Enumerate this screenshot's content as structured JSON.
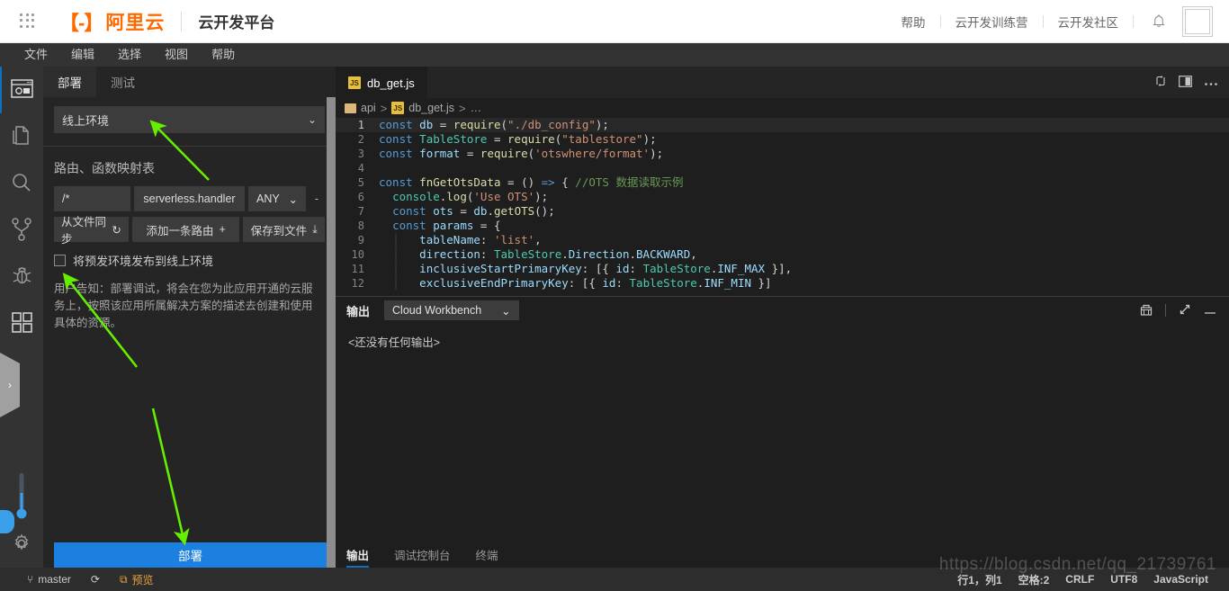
{
  "header": {
    "logo_mark": "【-】",
    "logo_text": "阿里云",
    "product": "云开发平台",
    "links": [
      "帮助",
      "云开发训练营",
      "云开发社区"
    ],
    "bell_icon": "bell-icon",
    "avatar_icon": "avatar-placeholder"
  },
  "menubar": {
    "items": [
      "文件",
      "编辑",
      "选择",
      "视图",
      "帮助"
    ]
  },
  "activitybar": {
    "items": [
      {
        "name": "cloud-workbench",
        "icon": "browser-window-icon",
        "active": true
      },
      {
        "name": "explorer",
        "icon": "files-icon",
        "active": false
      },
      {
        "name": "search",
        "icon": "search-icon",
        "active": false
      },
      {
        "name": "source-control",
        "icon": "git-branch-icon",
        "active": false
      },
      {
        "name": "debug",
        "icon": "bug-icon",
        "active": false
      },
      {
        "name": "extensions",
        "icon": "grid-squares-icon",
        "active": false
      }
    ],
    "bottom": [
      {
        "name": "thermometer",
        "icon": "thermometer-icon"
      },
      {
        "name": "settings",
        "icon": "gear-icon"
      }
    ],
    "flyout_chevron": "›"
  },
  "sidepanel": {
    "tabs": [
      {
        "label": "部署",
        "active": true
      },
      {
        "label": "测试",
        "active": false
      }
    ],
    "environment": {
      "value": "线上环境",
      "chevron": "⌄"
    },
    "section_title": "路由、函数映射表",
    "route_row": {
      "path": "/*",
      "handler": "serverless.handler",
      "method": "ANY",
      "method_chevron": "⌄",
      "delete": "-"
    },
    "buttons": [
      {
        "label": "从文件同步",
        "icon": "sync-icon",
        "glyph": "↻"
      },
      {
        "label": "添加一条路由",
        "icon": "plus-icon",
        "glyph": "+"
      },
      {
        "label": "保存到文件",
        "icon": "download-icon",
        "glyph": "⤓"
      }
    ],
    "checkbox": {
      "label": "将预发环境发布到线上环境",
      "checked": false
    },
    "note": "用户告知：部署调试，将会在您为此应用开通的云服务上，按照该应用所属解决方案的描述去创建和使用具体的资源。",
    "deploy_button": "部署"
  },
  "editor": {
    "tab": {
      "filename": "db_get.js",
      "badge": "JS"
    },
    "tab_icons": [
      "split-editor-icon",
      "split-layout-icon",
      "more-actions-icon"
    ],
    "breadcrumb": {
      "folder": "api",
      "file": "db_get.js",
      "ellipsis": "…",
      "separator": ">"
    },
    "code_lines": [
      {
        "n": "1",
        "t": "const db = require(\"./db_config\");"
      },
      {
        "n": "2",
        "t": "const TableStore = require(\"tablestore\");"
      },
      {
        "n": "3",
        "t": "const format = require('otswhere/format');"
      },
      {
        "n": "4",
        "t": ""
      },
      {
        "n": "5",
        "t": "const fnGetOtsData = () => { //OTS 数据读取示例"
      },
      {
        "n": "6",
        "t": "  console.log('Use OTS');"
      },
      {
        "n": "7",
        "t": "  const ots = db.getOTS();"
      },
      {
        "n": "8",
        "t": "  const params = {"
      },
      {
        "n": "9",
        "t": "      tableName: 'list',"
      },
      {
        "n": "10",
        "t": "      direction: TableStore.Direction.BACKWARD,"
      },
      {
        "n": "11",
        "t": "      inclusiveStartPrimaryKey: [{ id: TableStore.INF_MAX }],"
      },
      {
        "n": "12",
        "t": "      exclusiveEndPrimaryKey: [{ id: TableStore.INF_MIN }]"
      }
    ]
  },
  "panel": {
    "title": "输出",
    "source_select": "Cloud Workbench",
    "source_chevron": "⌄",
    "icons": [
      "clear-output-icon",
      "maximize-panel-icon",
      "close-panel-icon"
    ],
    "empty_message": "<还没有任何输出>",
    "tabs": [
      {
        "label": "输出",
        "active": true
      },
      {
        "label": "调试控制台",
        "active": false
      },
      {
        "label": "终端",
        "active": false
      }
    ]
  },
  "statusbar": {
    "left": [
      {
        "icon": "git-branch-icon",
        "glyph": "⑂",
        "label": "master"
      },
      {
        "icon": "sync-status-icon",
        "glyph": "⟳",
        "label": ""
      },
      {
        "icon": "preview-icon",
        "glyph": "⧉",
        "label": "预览",
        "warn": true
      }
    ],
    "right": [
      "行1，列1",
      "空格:2",
      "CRLF",
      "UTF8",
      "JavaScript"
    ]
  },
  "watermark": "https://blog.csdn.net/qq_21739761",
  "colors": {
    "brand_orange": "#ff6a00",
    "accent_blue": "#1b80e0",
    "arrow_green": "#66ee00",
    "warn_orange": "#e8a33d"
  }
}
